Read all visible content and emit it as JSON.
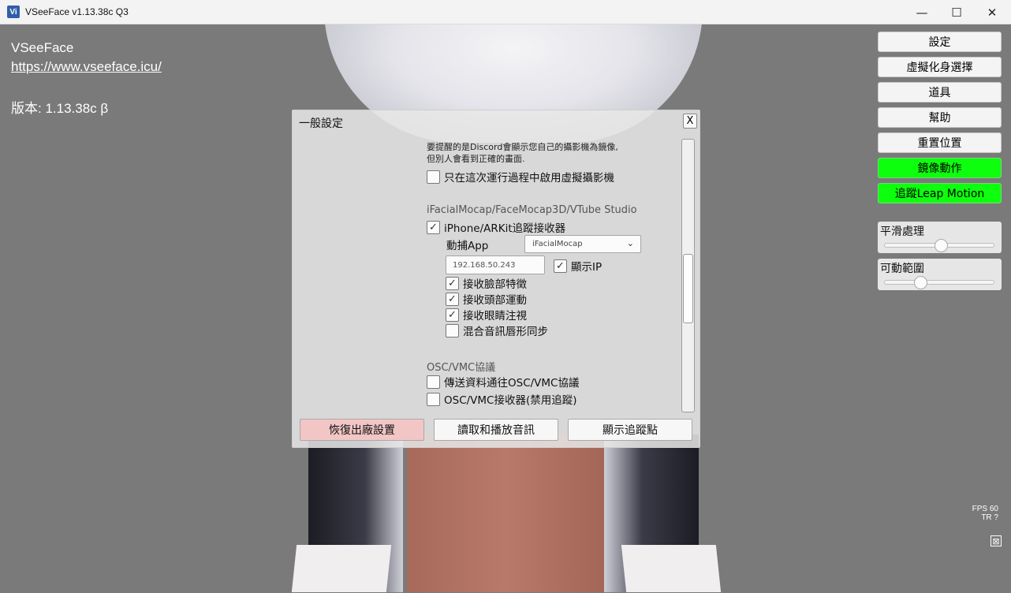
{
  "window": {
    "icon_text": "Vi",
    "title": "VSeeFace v1.13.38c Q3",
    "minimize": "—",
    "maximize": "☐",
    "close": "✕"
  },
  "info": {
    "name": "VSeeFace",
    "url": "https://www.vseeface.icu/",
    "version": "版本: 1.13.38c β"
  },
  "right_panel": {
    "buttons": [
      "設定",
      "虛擬化身選擇",
      "道具",
      "幫助",
      "重置位置",
      "鏡像動作",
      "追蹤Leap Motion"
    ],
    "active_color": "#0dff0d",
    "sliders": [
      {
        "label": "平滑處理",
        "value": 0.52
      },
      {
        "label": "可動範圍",
        "value": 0.33
      }
    ]
  },
  "status": {
    "fps": "FPS  60",
    "tr": "TR   ?"
  },
  "dialog": {
    "title": "一般設定",
    "close_label": "X",
    "note_line1": "要提醒的是Discord會顯示您自己的攝影機為鏡像,",
    "note_line2": "但別人會看到正確的畫面.",
    "virtual_cam_once": {
      "label": "只在這次運行過程中啟用虛擬攝影機",
      "checked": false
    },
    "section_ifacial": "iFacialMocap/FaceMocap3D/VTube Studio",
    "iphone_receiver": {
      "label": "iPhone/ARKit追蹤接收器",
      "checked": true
    },
    "mocap_app_label": "動捕App",
    "mocap_app_value": "iFacialMocap",
    "ip_value": "192.168.50.243",
    "show_ip": {
      "label": "顯示IP",
      "checked": true
    },
    "receive_options": [
      {
        "label": "接收臉部特徵",
        "checked": true
      },
      {
        "label": "接收頭部運動",
        "checked": true
      },
      {
        "label": "接收眼睛注視",
        "checked": true
      },
      {
        "label": "混合音訊唇形同步",
        "checked": false
      }
    ],
    "section_osc": "OSC/VMC協議",
    "osc_send": {
      "label": "傳送資料通往OSC/VMC協議",
      "checked": false
    },
    "osc_receive": {
      "label": "OSC/VMC接收器(禁用追蹤)",
      "checked": false
    },
    "buttons": {
      "reset": "恢復出廠設置",
      "audio": "讀取和播放音訊",
      "tracking_points": "顯示追蹤點"
    }
  },
  "check_glyph": "✓"
}
